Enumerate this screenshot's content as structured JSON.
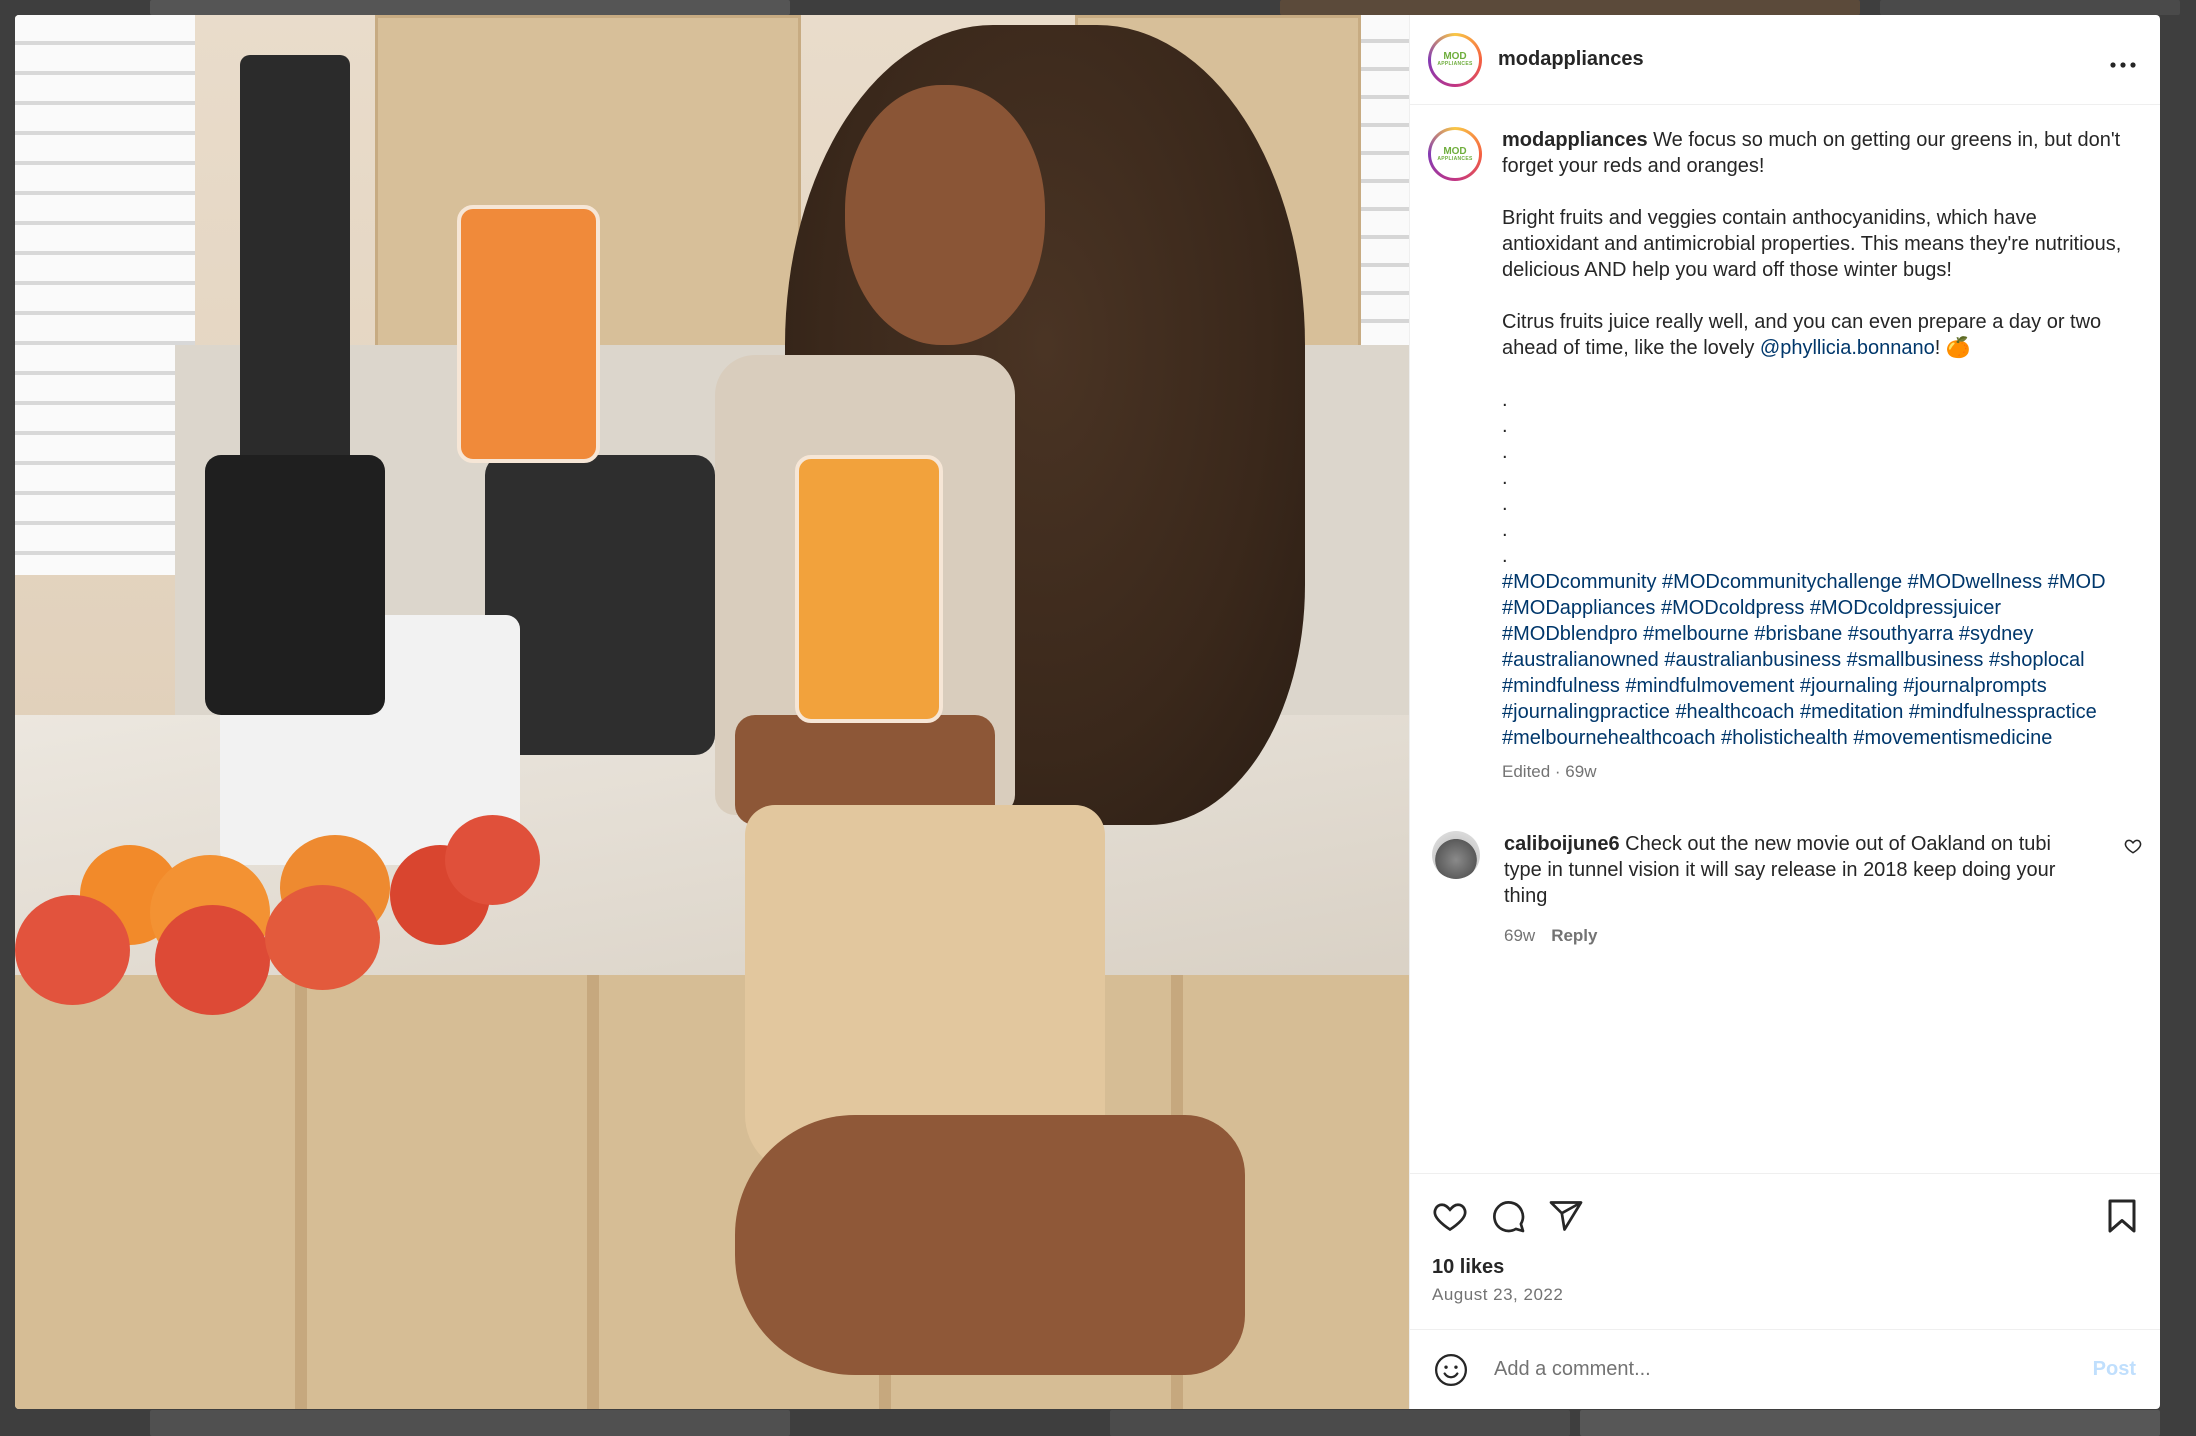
{
  "post": {
    "username": "modappliances",
    "avatar_logo_line1": "MOD",
    "avatar_logo_line2": "APPLIANCES",
    "more_icon": "more-horizontal-icon",
    "caption": {
      "username": "modappliances",
      "lines": [
        " We focus so much on getting our greens in, but don't forget your reds and oranges!",
        "Bright fruits and veggies contain anthocyanidins, which have antioxidant and antimicrobial properties. This means they're nutritious, delicious AND help you ward off those winter bugs!",
        "Citrus fruits juice really well, and you can even prepare a day or two ahead of time, like the lovely "
      ],
      "mention": "@phyllicia.bonnano",
      "mention_suffix": "! 🍊",
      "dots": [
        ".",
        ".",
        ".",
        ".",
        ".",
        ".",
        "."
      ],
      "hashtags": "#MODcommunity #MODcommunitychallenge #MODwellness #MOD #MODappliances #MODcoldpress #MODcoldpressjuicer #MODblendpro #melbourne #brisbane #southyarra #sydney #australianowned #australianbusiness #smallbusiness #shoplocal #mindfulness #mindfulmovement #journaling #journalprompts #journalingpractice #healthcoach #meditation #mindfulnesspractice #melbournehealthcoach #holistichealth #movementismedicine",
      "meta": "Edited · 69w"
    },
    "comments": [
      {
        "username": "caliboijune6",
        "text": " Check out the new movie out of Oakland on tubi type in tunnel vision it will say release in 2018 keep doing your thing",
        "age": "69w",
        "reply_label": "Reply"
      }
    ],
    "likes": "10 likes",
    "date": "August 23, 2022",
    "add_comment_placeholder": "Add a comment...",
    "post_label": "Post"
  },
  "colors": {
    "link": "#00376b",
    "muted": "#737373",
    "post_disabled": "#c0dffd"
  }
}
